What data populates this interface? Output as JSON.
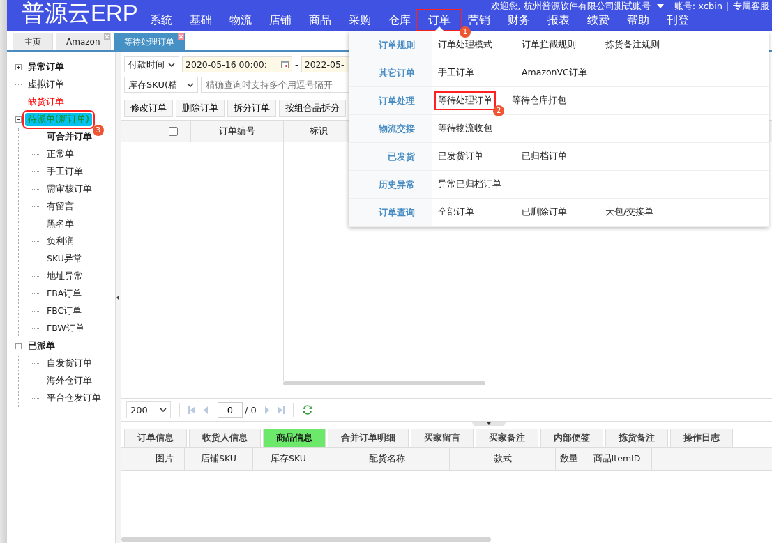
{
  "header": {
    "logo": "普源云ERP",
    "welcome": "欢迎您, 杭州普源软件有限公司测试账号",
    "account": "账号: xcbin",
    "service": "专属客服",
    "nav": [
      {
        "label": "系统",
        "selected": false
      },
      {
        "label": "基础",
        "selected": false
      },
      {
        "label": "物流",
        "selected": false
      },
      {
        "label": "店铺",
        "selected": false
      },
      {
        "label": "商品",
        "selected": false
      },
      {
        "label": "采购",
        "selected": false
      },
      {
        "label": "仓库",
        "selected": false
      },
      {
        "label": "订单",
        "selected": true,
        "marker": "1"
      },
      {
        "label": "营销",
        "selected": false
      },
      {
        "label": "财务",
        "selected": false
      },
      {
        "label": "报表",
        "selected": false
      },
      {
        "label": "续费",
        "selected": false
      },
      {
        "label": "帮助",
        "selected": false
      },
      {
        "label": "刊登",
        "selected": false
      }
    ]
  },
  "tabs": [
    {
      "label": "主页",
      "selected": false,
      "closable": false
    },
    {
      "label": "Amazon",
      "selected": false,
      "closable": true
    },
    {
      "label": "等待处理订单",
      "selected": true,
      "closable": true
    }
  ],
  "sidebar": {
    "tree": [
      {
        "label": "异常订单",
        "bold": true,
        "alert": false,
        "selected": false,
        "expanded": false
      },
      {
        "label": "虚拟订单",
        "bold": false,
        "alert": false,
        "selected": false
      },
      {
        "label": "缺货订单",
        "bold": false,
        "alert": true,
        "selected": false
      },
      {
        "label": "待派单(新订单)",
        "bold": false,
        "alert": false,
        "selected": true,
        "expanded": true,
        "marker": "3",
        "children": [
          {
            "label": "可合并订单",
            "bold": true,
            "alert": false,
            "selected": false
          },
          {
            "label": "正常单",
            "bold": false,
            "alert": false,
            "selected": false
          },
          {
            "label": "手工订单",
            "bold": false,
            "alert": false,
            "selected": false
          },
          {
            "label": "需审核订单",
            "bold": false,
            "alert": false,
            "selected": false
          },
          {
            "label": "有留言",
            "bold": false,
            "alert": false,
            "selected": false
          },
          {
            "label": "黑名单",
            "bold": false,
            "alert": false,
            "selected": false
          },
          {
            "label": "负利润",
            "bold": false,
            "alert": false,
            "selected": false
          },
          {
            "label": "SKU异常",
            "bold": false,
            "alert": false,
            "selected": false
          },
          {
            "label": "地址异常",
            "bold": false,
            "alert": false,
            "selected": false
          },
          {
            "label": "FBA订单",
            "bold": false,
            "alert": false,
            "selected": false
          },
          {
            "label": "FBC订单",
            "bold": false,
            "alert": false,
            "selected": false
          },
          {
            "label": "FBW订单",
            "bold": false,
            "alert": false,
            "selected": false
          }
        ]
      },
      {
        "label": "已派单",
        "bold": true,
        "alert": false,
        "selected": false,
        "expanded": true,
        "children": [
          {
            "label": "自发货订单",
            "bold": false,
            "alert": false,
            "selected": false
          },
          {
            "label": "海外仓订单",
            "bold": false,
            "alert": false,
            "selected": false
          },
          {
            "label": "平台仓发订单",
            "bold": false,
            "alert": false,
            "selected": false
          }
        ]
      }
    ]
  },
  "filters": {
    "time_field": "付款时间",
    "date_from": "2020-05-16 00:00:",
    "date_separator": "-",
    "date_to": "2022-05-",
    "sku_field": "库存SKU(精",
    "query": {
      "placeholder": "精确查询时支持多个用逗号隔开"
    }
  },
  "toolbar": [
    "修改订单",
    "删除订单",
    "拆分订单",
    "按组合品拆分"
  ],
  "order_table": {
    "columns": [
      {
        "kind": "blank"
      },
      {
        "kind": "checkbox",
        "checked": false
      },
      {
        "kind": "text",
        "label": "订单编号"
      },
      {
        "kind": "text",
        "label": "标识"
      }
    ]
  },
  "pager": {
    "page_size": "200",
    "page": "0",
    "total": "/ 0"
  },
  "detail_tabs": [
    {
      "label": "订单信息",
      "selected": false
    },
    {
      "label": "收货人信息",
      "selected": false
    },
    {
      "label": "商品信息",
      "selected": true
    },
    {
      "label": "合并订单明细",
      "selected": false
    },
    {
      "label": "买家留言",
      "selected": false
    },
    {
      "label": "买家备注",
      "selected": false
    },
    {
      "label": "内部便签",
      "selected": false
    },
    {
      "label": "拣货备注",
      "selected": false
    },
    {
      "label": "操作日志",
      "selected": false
    }
  ],
  "detail_table": {
    "columns": [
      "图片",
      "店铺SKU",
      "库存SKU",
      "配货名称",
      "款式",
      "数量",
      "商品ItemID"
    ]
  },
  "menu": {
    "groups": [
      {
        "label": "订单规则",
        "items": [
          {
            "label": "订单处理模式"
          },
          {
            "label": "订单拦截规则"
          },
          {
            "label": "拣货备注规则"
          }
        ]
      },
      {
        "label": "其它订单",
        "items": [
          {
            "label": "手工订单"
          },
          {
            "label": "AmazonVC订单"
          }
        ]
      },
      {
        "label": "订单处理",
        "items": [
          {
            "label": "等待处理订单",
            "marker": "2"
          },
          {
            "label": "等待仓库打包"
          }
        ]
      },
      {
        "label": "物流交接",
        "items": [
          {
            "label": "等待物流收包"
          }
        ]
      },
      {
        "label": "已发货",
        "items": [
          {
            "label": "已发货订单"
          },
          {
            "label": "已归档订单"
          }
        ]
      },
      {
        "label": "历史异常",
        "items": [
          {
            "label": "异常已归档订单"
          }
        ]
      },
      {
        "label": "订单查询",
        "items": [
          {
            "label": "全部订单"
          },
          {
            "label": "已删除订单"
          },
          {
            "label": "大包/交接单"
          }
        ]
      }
    ]
  }
}
